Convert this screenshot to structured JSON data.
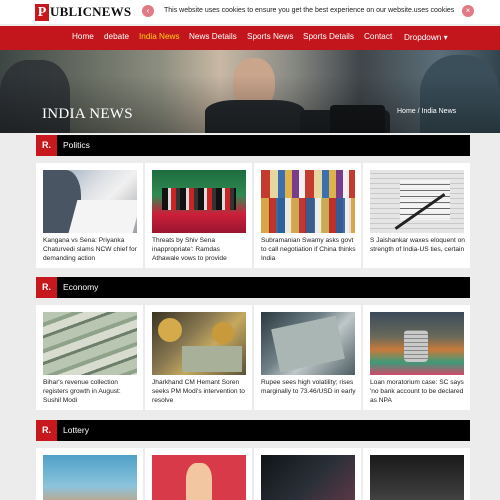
{
  "brand": {
    "initial": "P",
    "rest": "UBLICNEWS"
  },
  "cookie": {
    "text": "This website uses cookies to ensure you get the best experience on our website.uses cookies",
    "left_icon": "chevron-left-icon",
    "right_icon": "close-icon"
  },
  "nav": [
    {
      "label": "Home",
      "active": false
    },
    {
      "label": "debate",
      "active": false
    },
    {
      "label": "India News",
      "active": true
    },
    {
      "label": "News Details",
      "active": false
    },
    {
      "label": "Sports News",
      "active": false
    },
    {
      "label": "Sports Details",
      "active": false
    },
    {
      "label": "Contact",
      "active": false
    },
    {
      "label": "Dropdown ▾",
      "active": false
    }
  ],
  "hero": {
    "title": "INDIA NEWS",
    "breadcrumb": "Home  /  India News"
  },
  "sections": [
    {
      "badge": "R.",
      "title": "Politics",
      "cards": [
        {
          "text": "Kangana vs Sena: Priyanka Chaturvedi slams NCW chief for demanding action"
        },
        {
          "text": "Threats by Shiv Sena inappropriate': Ramdas Athawale vows to provide"
        },
        {
          "text": "Subramanian Swamy asks govt to call negotiation if China thinks India"
        },
        {
          "text": "S Jaishankar waxes eloquent on strength of India-US ties, certain"
        }
      ]
    },
    {
      "badge": "R.",
      "title": "Economy",
      "cards": [
        {
          "text": "Bihar's revenue collection registers growth in August: Sushil Modi"
        },
        {
          "text": "Jharkhand CM Hemant Soren seeks PM Modi's intervention to resolve"
        },
        {
          "text": "Rupee sees high volatility; rises marginally to 73.46/USD in early"
        },
        {
          "text": "Loan moratorium case: SC says 'no bank account to be declared as NPA"
        }
      ]
    },
    {
      "badge": "R.",
      "title": "Lottery",
      "cards": [
        {
          "text": ""
        },
        {
          "text": ""
        },
        {
          "text": ""
        },
        {
          "text": ""
        }
      ]
    }
  ],
  "colors": {
    "brand_red": "#c6181d",
    "nav_red": "#c3161c",
    "active_nav": "#ffd11a",
    "section_bar": "#000000"
  }
}
